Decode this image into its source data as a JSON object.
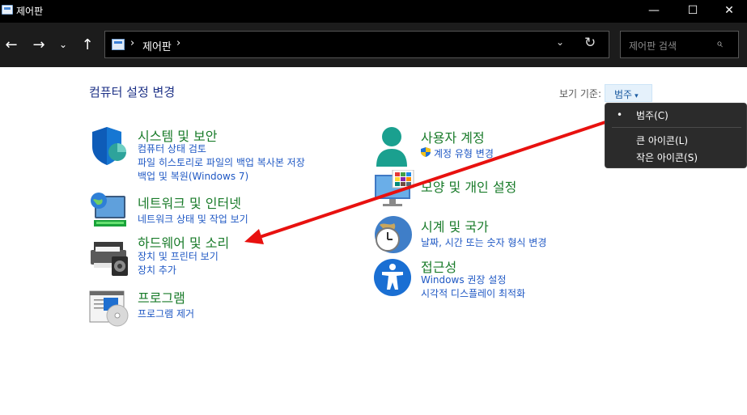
{
  "window": {
    "title": "제어판",
    "min_icon": "—",
    "max_icon": "☐",
    "close_icon": "✕"
  },
  "nav": {
    "back": "←",
    "forward": "→",
    "recent": "⌄",
    "up": "↑"
  },
  "address": {
    "separator": "›",
    "location": "제어판",
    "dropdown": "⌄",
    "refresh": "↻"
  },
  "search": {
    "placeholder": "제어판 검색",
    "icon": "⌕"
  },
  "page": {
    "title": "컴퓨터 설정 변경"
  },
  "view_by": {
    "label": "보기 기준:",
    "selected": "범주",
    "caret": "▾"
  },
  "view_menu": {
    "bullet": "•",
    "items": [
      "범주(C)",
      "큰 아이콘(L)",
      "작은 아이콘(S)"
    ]
  },
  "categories": {
    "system": {
      "title": "시스템 및 보안",
      "links": [
        "컴퓨터 상태 검토",
        "파일 히스토리로 파일의 백업 복사본 저장",
        "백업 및 복원(Windows 7)"
      ]
    },
    "network": {
      "title": "네트워크 및 인터넷",
      "links": [
        "네트워크 상태 및 작업 보기"
      ]
    },
    "hardware": {
      "title": "하드웨어 및 소리",
      "links": [
        "장치 및 프린터 보기",
        "장치 추가"
      ]
    },
    "programs": {
      "title": "프로그램",
      "links": [
        "프로그램 제거"
      ]
    },
    "accounts": {
      "title": "사용자 계정",
      "links": [
        "계정 유형 변경"
      ]
    },
    "appearance": {
      "title": "모양 및 개인 설정",
      "links": []
    },
    "clock": {
      "title": "시계 및 국가",
      "links": [
        "날짜, 시간 또는 숫자 형식 변경"
      ]
    },
    "access": {
      "title": "접근성",
      "links": [
        "Windows 권장 설정",
        "시각적 디스플레이 최적화"
      ]
    }
  },
  "colors": {
    "category_title": "#197b2a",
    "link": "#1f58c4",
    "annotation_arrow": "#e8110f"
  }
}
